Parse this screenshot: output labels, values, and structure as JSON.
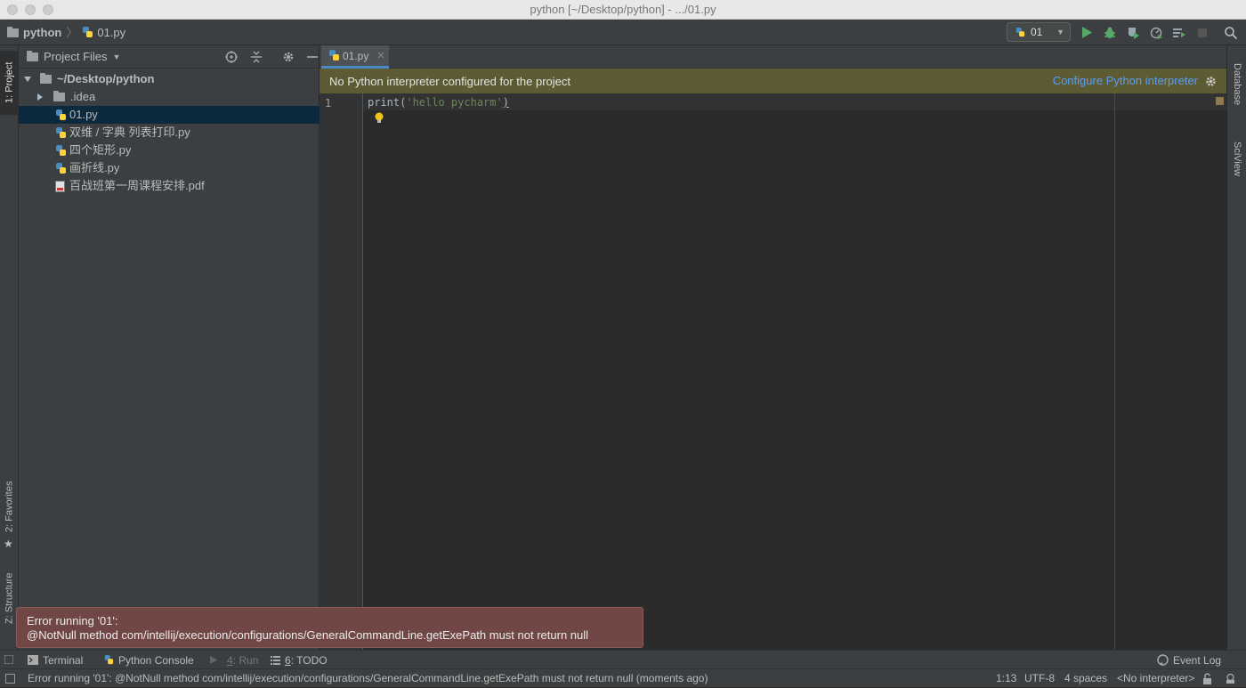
{
  "window": {
    "title": "python [~/Desktop/python] - .../01.py"
  },
  "navbar": {
    "crumb_project": "python",
    "crumb_file": "01.py",
    "run_config": "01"
  },
  "left_strip": {
    "project_tab": "1: Project",
    "favorites_tab": "2: Favorites",
    "structure_tab": "Z: Structure"
  },
  "right_strip": {
    "database_tab": "Database",
    "sciview_tab": "SciView"
  },
  "project_panel": {
    "title": "Project Files",
    "root": "~/Desktop/python",
    "items": [
      {
        "label": ".idea",
        "type": "folder"
      },
      {
        "label": "01.py",
        "type": "py",
        "selected": true
      },
      {
        "label": "双维 / 字典 列表打印.py",
        "type": "py"
      },
      {
        "label": "四个矩形.py",
        "type": "py"
      },
      {
        "label": "画折线.py",
        "type": "py"
      },
      {
        "label": "百战班第一周课程安排.pdf",
        "type": "pdf"
      }
    ]
  },
  "editor": {
    "tab_label": "01.py",
    "banner_text": "No Python interpreter configured for the project",
    "banner_link": "Configure Python interpreter",
    "line_number": "1",
    "code_func": "print",
    "code_open": "(",
    "code_string": "'hello pycharm'",
    "code_close": ")"
  },
  "error_toast": {
    "line1": "Error running '01':",
    "line2": "@NotNull method com/intellij/execution/configurations/GeneralCommandLine.getExePath must not return null"
  },
  "tool_windows": {
    "terminal": "Terminal",
    "python_console": "Python Console",
    "run_num": "4",
    "run": ": Run",
    "todo_num": "6",
    "todo": ": TODO",
    "event_log": "Event Log"
  },
  "status_bar": {
    "message": "Error running '01': @NotNull method com/intellij/execution/configurations/GeneralCommandLine.getExePath must not return null (moments ago)",
    "position": "1:13",
    "encoding": "UTF-8",
    "indent": "4 spaces",
    "interpreter": "<No interpreter>"
  },
  "colors": {
    "accent": "#4a88c7",
    "banner_bg": "#5c5b34",
    "link": "#589df6",
    "error_bg": "#704745",
    "run_green": "#59a869"
  }
}
